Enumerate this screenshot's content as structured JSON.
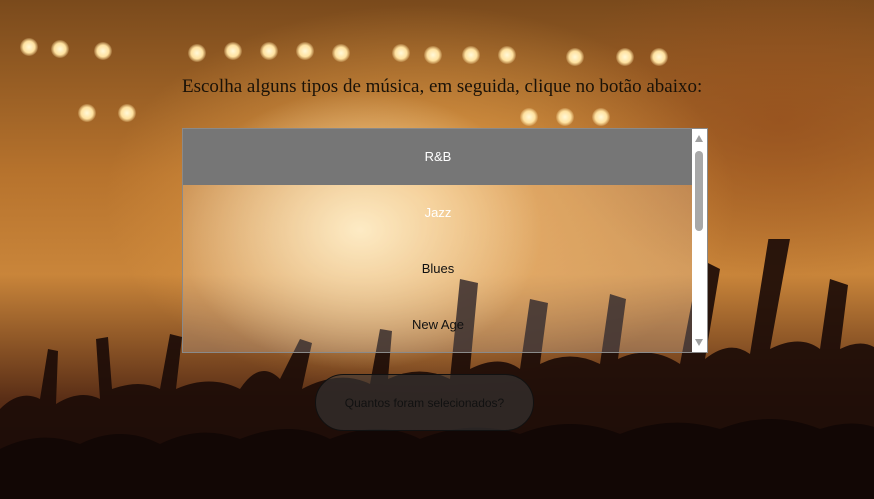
{
  "page": {
    "heading": "Escolha alguns tipos de música, em seguida, clique no botão abaixo:"
  },
  "music_select": {
    "options": [
      {
        "label": "R&B",
        "selected": true
      },
      {
        "label": "Jazz",
        "selected": false
      },
      {
        "label": "Blues",
        "selected": false
      },
      {
        "label": "New Age",
        "selected": false
      }
    ]
  },
  "actions": {
    "count_button_label": "Quantos foram selecionados?"
  },
  "colors": {
    "selected_option_bg": "#767676",
    "background_tone": "#c9853a"
  }
}
